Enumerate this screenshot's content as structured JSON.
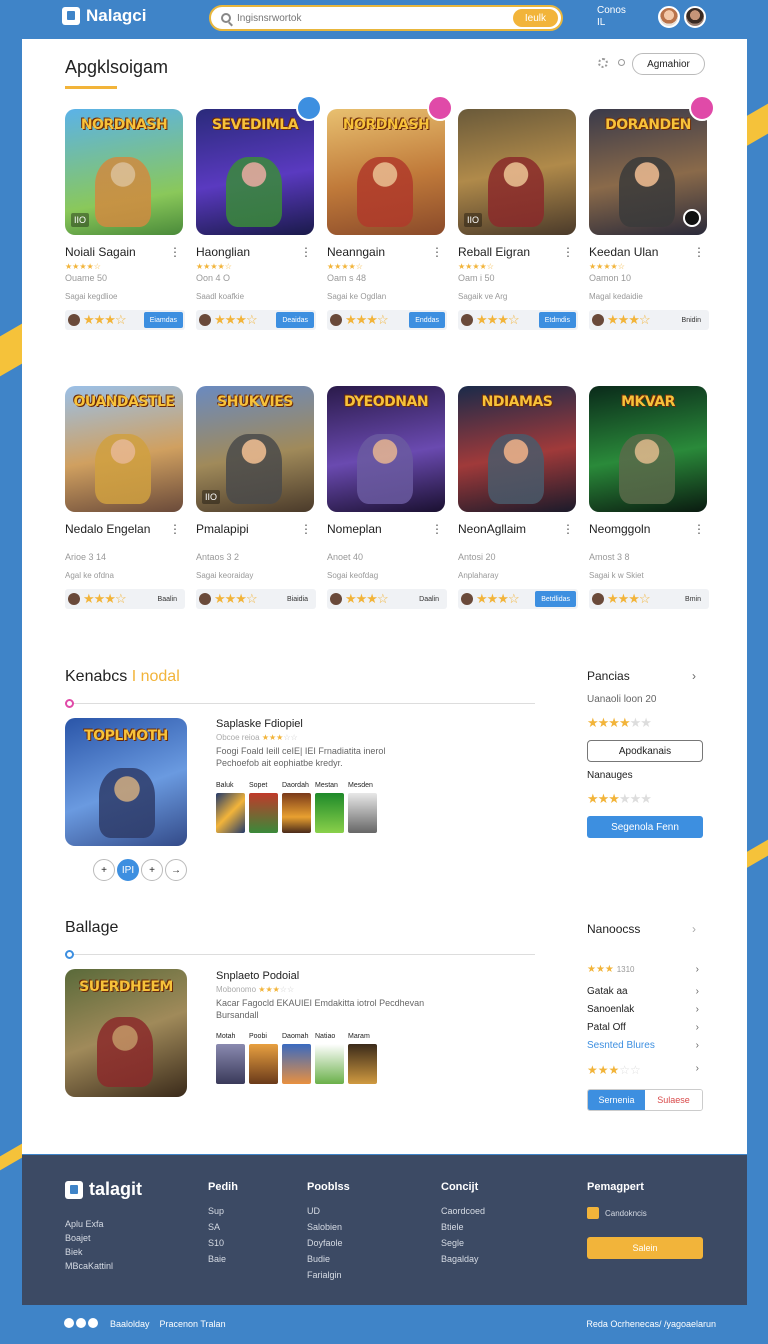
{
  "brand": {
    "name": "Nalagci"
  },
  "search": {
    "placeholder": "Ingisnsrwortok",
    "button": "Ieulk"
  },
  "account": {
    "line1": "Conos",
    "line2": "IL"
  },
  "section1": {
    "title": "Apgklsoigam",
    "button": "Agmahior"
  },
  "games_row1": [
    {
      "art": "NORDNASH",
      "name": "Noiali Sagain",
      "meta": "Ouame 50",
      "sub": "Sagai kegdlioe",
      "tag": "IIO",
      "chip": "Eiamdas",
      "chip_style": "blue"
    },
    {
      "art": "SEVEDIMLA",
      "name": "Haonglian",
      "meta": "Oon 4 O",
      "sub": "Saadl koafkie",
      "tag": "",
      "chip": "Deaidas",
      "chip_style": "blue"
    },
    {
      "art": "NORDNASH",
      "name": "Neanngain",
      "meta": "Oam s 48",
      "sub": "Sagai ke Ogdlan",
      "tag": "",
      "chip": "Enddas",
      "chip_style": "blue"
    },
    {
      "art": "",
      "name": "Reball Eigran",
      "meta": "Oam i 50",
      "sub": "Sagaik ve Arg",
      "tag": "IIO",
      "chip": "Etdmdis",
      "chip_style": "blue"
    },
    {
      "art": "DORANDEN",
      "name": "Keedan Ulan",
      "meta": "Oamon 10",
      "sub": "Magal kedaidie",
      "tag": "",
      "chip": "Bnidin",
      "chip_style": "grey"
    }
  ],
  "games_row2": [
    {
      "art": "OUANDASTLE",
      "name": "Nedalo Engelan",
      "meta": "Arioe 3 14",
      "sub": "Agal ke ofdna",
      "tag": "",
      "chip": "Baalin",
      "chip_style": "grey"
    },
    {
      "art": "SHUKVIES",
      "name": "Pmalapipi",
      "meta": "Antaos 3 2",
      "sub": "Sagai keoraiday",
      "tag": "IIO",
      "chip": "Biaidia",
      "chip_style": "grey"
    },
    {
      "art": "DYEODNAN",
      "name": "Nomeplan",
      "meta": "Anoet 40",
      "sub": "Sogai keofdag",
      "tag": "",
      "chip": "Daalin",
      "chip_style": "grey"
    },
    {
      "art": "NDIAMAS",
      "name": "NeonAgllaim",
      "meta": "Antosi 20",
      "sub": "Anplaharay",
      "tag": "",
      "chip": "Betdlidas",
      "chip_style": "blue"
    },
    {
      "art": "MKVAR",
      "name": "Neomggoln",
      "meta": "Amost 3 8",
      "sub": "Sagai k w Skiet",
      "tag": "",
      "chip": "Bmin",
      "chip_style": "grey"
    }
  ],
  "feature1": {
    "title": "Kenabcs",
    "accent": "I nodal",
    "art": "TOPLMOTH",
    "name": "Saplaske Fdiopiel",
    "rate_label": "Obcoe reioa",
    "desc": "Foogi Foald Ieill ceIE| IEI Frnadiatita inerol Pechoefob ait eophiatbe kredyr.",
    "shot_labels": [
      "Baluk",
      "Sopet",
      "Daordah",
      "Mestan",
      "Mesden"
    ],
    "pager": [
      "+",
      "IPI",
      "+",
      "→"
    ]
  },
  "feature2": {
    "title": "Ballage",
    "art": "SUERDHEEM",
    "name": "Snplaeto Podoial",
    "rate_label": "Mobonomo",
    "desc": "Kacar Fagocld EKAUIEI Emdakitta iotrol Pecdhevan Bursandall",
    "shot_labels": [
      "Motah",
      "Poobi",
      "Daomah",
      "Natiao",
      "Maram"
    ]
  },
  "sidebar1": {
    "title": "Pancias",
    "text": "Uanaoli loon 20",
    "outline_button": "Apodkanais",
    "sub_title": "Nanauges",
    "solid_button": "Segenola Fenn"
  },
  "sidebar2": {
    "title": "Nanoocss",
    "rate_text": "1310",
    "rows": [
      {
        "label": "Gatak aa",
        "style": "plain"
      },
      {
        "label": "Sanoenlak",
        "style": "plain"
      },
      {
        "label": "Patal Off",
        "style": "plain"
      },
      {
        "label": "Sesnted Blures",
        "style": "link"
      }
    ],
    "split_left": "Sernenia",
    "split_right": "Sulaese"
  },
  "footer": {
    "brand": "talagit",
    "left": [
      "Aplu Exfa",
      "Boajet",
      "Biek",
      "MBcaKattinl"
    ],
    "cols": [
      {
        "title": "Pedih",
        "items": [
          "Sup",
          "SA",
          "S10",
          "Baie"
        ]
      },
      {
        "title": "Pooblss",
        "items": [
          "UD",
          "Salobien",
          "Doyfaole",
          "Budie",
          "Farialgin"
        ]
      },
      {
        "title": "Concijt",
        "items": [
          "Caordcoed",
          "Btiele",
          "Segle",
          "Bagalday"
        ]
      }
    ],
    "newsletter_title": "Pemagpert",
    "newsletter_check": "Candokncis",
    "newsletter_button": "Salein"
  },
  "bottom": {
    "left_a": "Baalolday",
    "left_b": "Pracenon Tralan",
    "right": "Reda Ocrhenecas/ /yagoaelarun"
  },
  "colors": {
    "accent": "#f2b43a",
    "primary": "#3d8fe0",
    "background": "#3f84c8",
    "footer": "#3c4a64"
  }
}
